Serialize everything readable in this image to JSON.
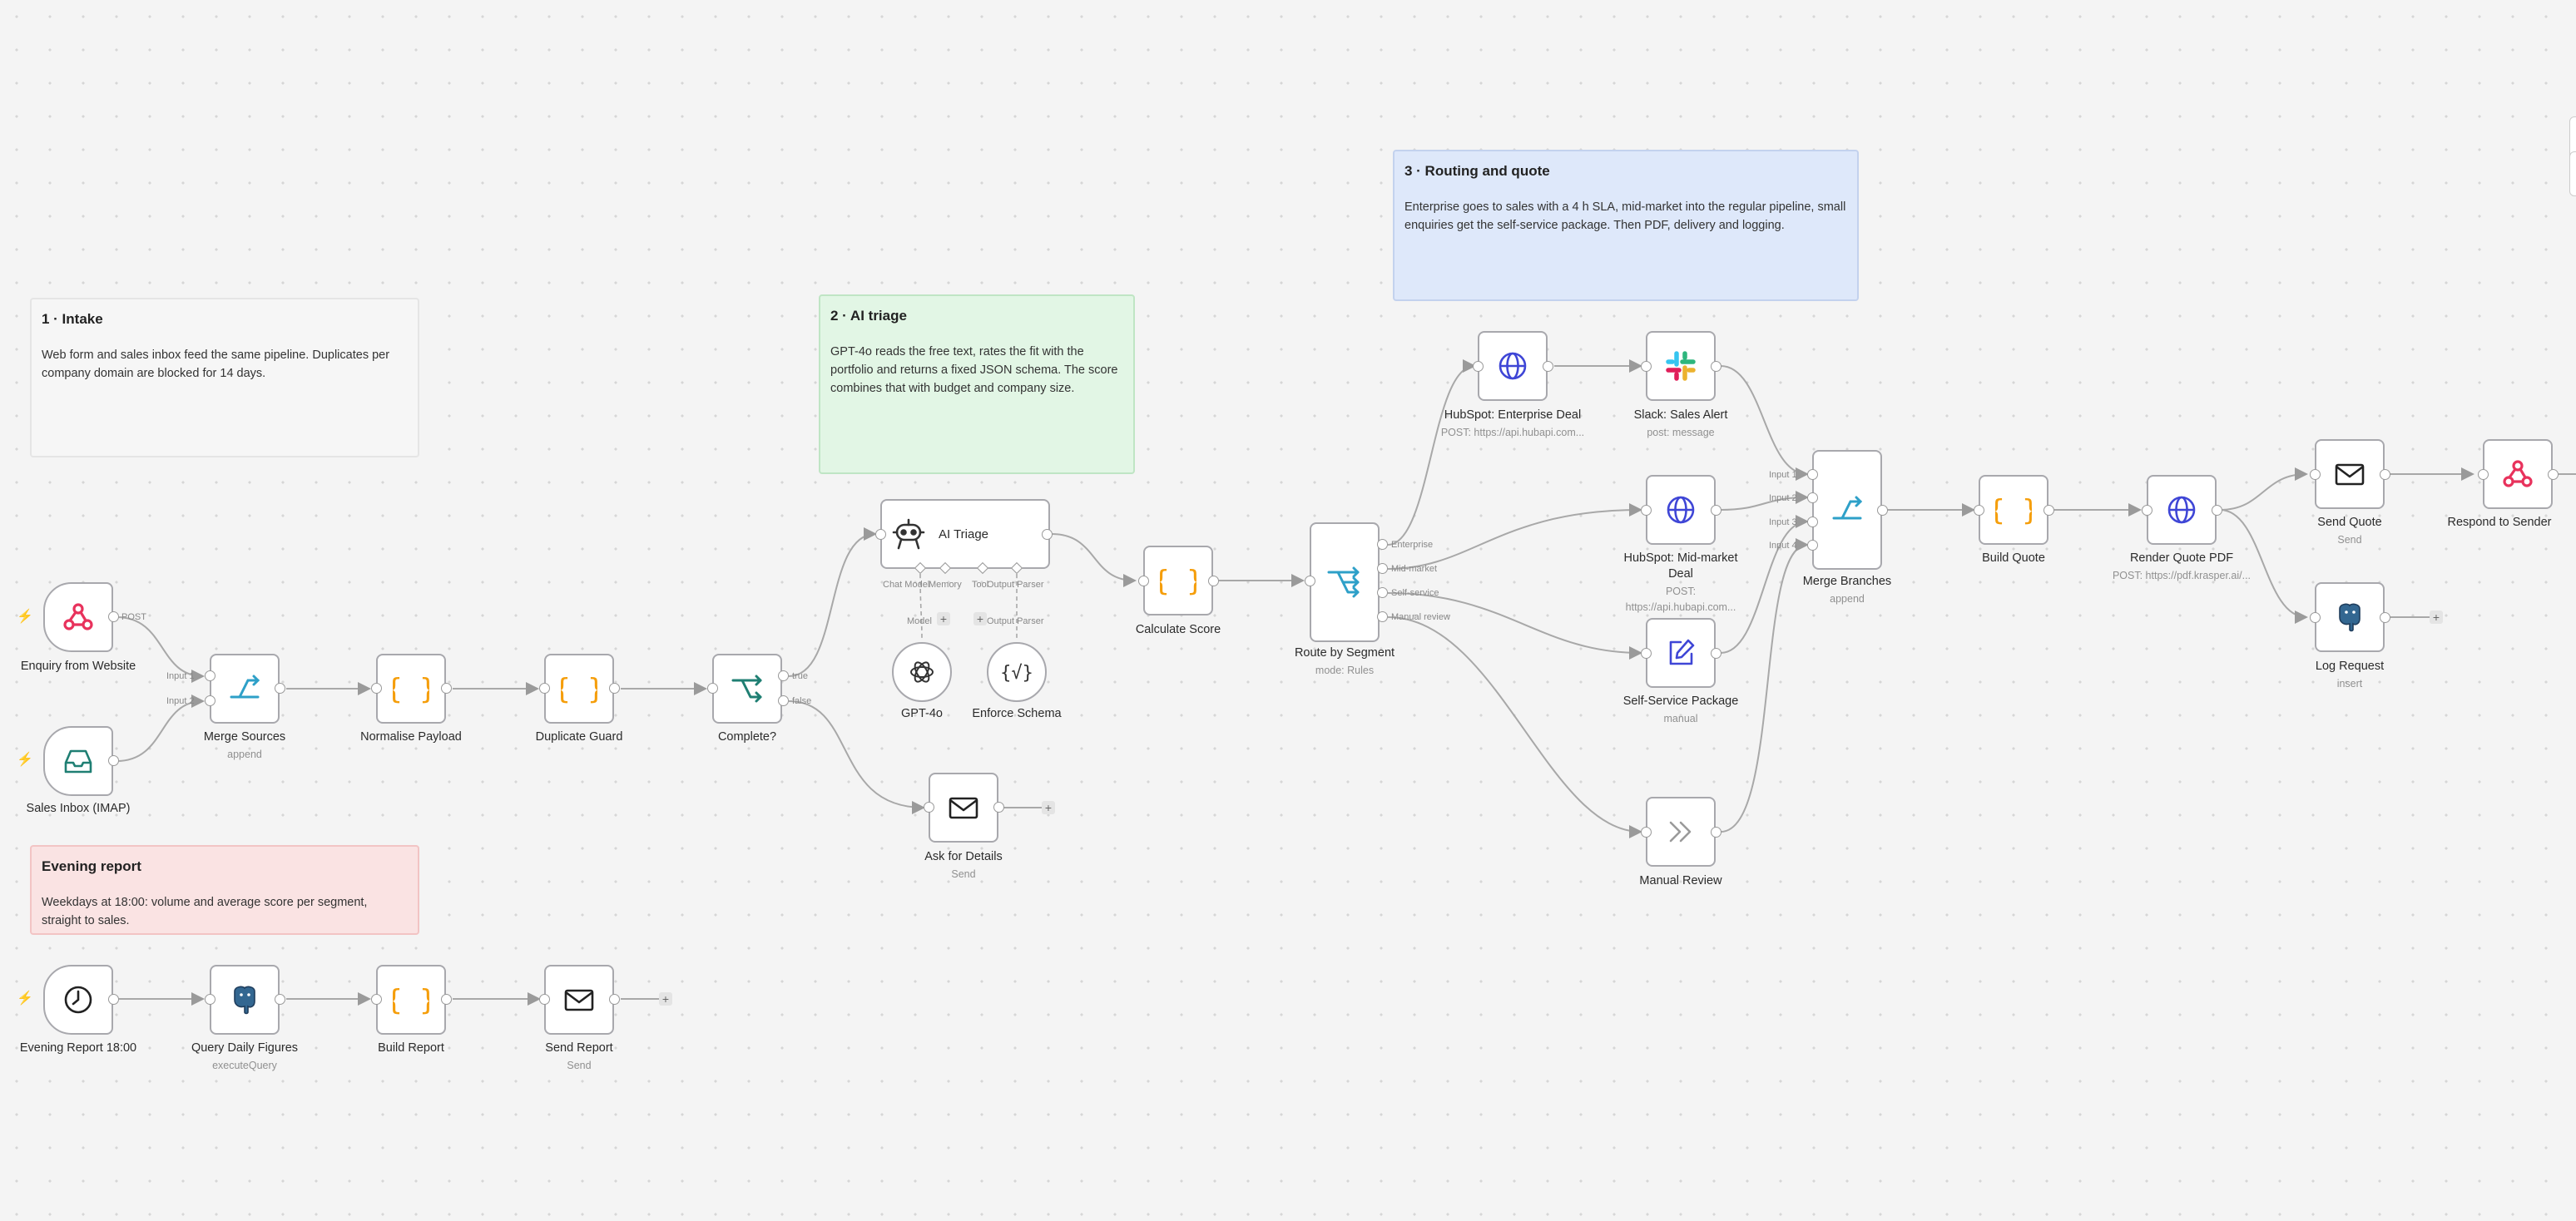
{
  "stickies": {
    "intake": {
      "title": "1 · Intake",
      "body": "Web form and sales inbox feed the same pipeline. Duplicates per company domain are blocked for 14 days."
    },
    "triage": {
      "title": "2 · AI triage",
      "body": "GPT-4o reads the free text, rates the fit with the portfolio and returns a fixed JSON schema. The score combines that with budget and company size."
    },
    "routing": {
      "title": "3 · Routing and quote",
      "body": "Enterprise goes to sales with a 4 h SLA, mid-market into the regular pipeline, small enquiries get the self-service package. Then PDF, delivery and logging."
    },
    "evening": {
      "title": "Evening report",
      "body": "Weekdays at 18:00: volume and average score per segment, straight to sales."
    }
  },
  "nodes": {
    "enquiry": {
      "name": "Enquiry from Website",
      "icon": "webhook-icon"
    },
    "inbox": {
      "name": "Sales Inbox (IMAP)",
      "icon": "inbox-icon"
    },
    "merge_sources": {
      "name": "Merge Sources",
      "sub": "append",
      "icon": "merge-icon"
    },
    "normalise": {
      "name": "Normalise Payload",
      "icon": "code-braces-icon"
    },
    "duplicate": {
      "name": "Duplicate Guard",
      "icon": "code-braces-icon"
    },
    "complete": {
      "name": "Complete?",
      "icon": "if-branch-icon"
    },
    "ai_triage": {
      "name": "AI Triage",
      "icon": "robot-icon"
    },
    "gpt4o": {
      "name": "GPT-4o",
      "icon": "openai-icon"
    },
    "enforce_schema": {
      "name": "Enforce Schema",
      "icon": "json-parser-icon"
    },
    "ask_details": {
      "name": "Ask for Details",
      "sub": "Send",
      "icon": "mail-icon"
    },
    "calculate": {
      "name": "Calculate Score",
      "icon": "code-braces-icon"
    },
    "route": {
      "name": "Route by Segment",
      "sub": "mode: Rules",
      "icon": "switch-icon"
    },
    "hubspot_ent": {
      "name": "HubSpot: Enterprise Deal",
      "sub": "POST: https://api.hubapi.com...",
      "icon": "globe-icon"
    },
    "slack": {
      "name": "Slack: Sales Alert",
      "sub": "post: message",
      "icon": "slack-icon"
    },
    "hubspot_mid": {
      "name": "HubSpot: Mid-market Deal",
      "sub": "POST: https://api.hubapi.com...",
      "icon": "globe-icon"
    },
    "self_service": {
      "name": "Self-Service Package",
      "sub": "manual",
      "icon": "edit-icon"
    },
    "manual_review": {
      "name": "Manual Review",
      "icon": "double-chevron-icon"
    },
    "merge_branches": {
      "name": "Merge Branches",
      "sub": "append",
      "icon": "merge-icon"
    },
    "build_quote": {
      "name": "Build Quote",
      "icon": "code-braces-icon"
    },
    "render_pdf": {
      "name": "Render Quote PDF",
      "sub": "POST: https://pdf.krasper.ai/...",
      "icon": "globe-icon"
    },
    "send_quote": {
      "name": "Send Quote",
      "sub": "Send",
      "icon": "mail-icon"
    },
    "respond": {
      "name": "Respond to Sender",
      "icon": "webhook-icon"
    },
    "log_request": {
      "name": "Log Request",
      "sub": "insert",
      "icon": "postgres-icon"
    },
    "evening_trigger": {
      "name": "Evening Report 18:00",
      "icon": "clock-icon"
    },
    "query_daily": {
      "name": "Query Daily Figures",
      "sub": "executeQuery",
      "icon": "postgres-icon"
    },
    "build_report": {
      "name": "Build Report",
      "icon": "code-braces-icon"
    },
    "send_report": {
      "name": "Send Report",
      "sub": "Send",
      "icon": "mail-icon"
    }
  },
  "port_labels": {
    "post": "POST",
    "input1": "Input 1",
    "input2": "Input 2",
    "input3": "Input 3",
    "input4": "Input 4",
    "true": "true",
    "false": "false",
    "chat_model": "Chat Model",
    "memory": "Memory",
    "tool": "Tool",
    "output_parser": "Output Parser",
    "model": "Model",
    "enterprise": "Enterprise",
    "mid_market": "Mid-market",
    "self_service": "Self-service",
    "manual_review": "Manual review"
  },
  "colors": {
    "canvas": "#f4f4f4",
    "trigger_bolt": "#ff6d2d",
    "webhook": "#e8325c",
    "code": "#f59e0b",
    "http": "#3f46d6",
    "merge": "#2ea0c8",
    "if": "#1f7f73",
    "sticky_intake": "#f6f6f6",
    "sticky_triage": "#e2f6e5",
    "sticky_routing": "#dee8fa",
    "sticky_evening": "#fae3e3"
  },
  "plus_symbol": "+"
}
